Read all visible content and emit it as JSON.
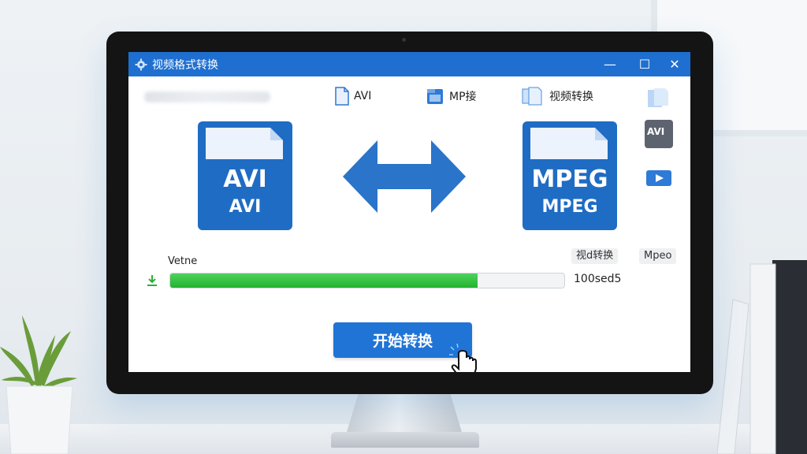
{
  "window": {
    "title": "视频格式转换",
    "controls": {
      "minimize": "—",
      "maximize": "☐",
      "close": "✕"
    }
  },
  "tabs": [
    {
      "label": "AVI",
      "icon": "document-icon"
    },
    {
      "label": "MP接",
      "icon": "folder-file-icon"
    },
    {
      "label": "视频转换",
      "icon": "copy-files-icon"
    }
  ],
  "source_file": {
    "label_top": "AVI",
    "label_bottom": "AVI",
    "color": "#1f6cc4"
  },
  "target_file": {
    "label_top": "MPEG",
    "label_bottom": "MPEG",
    "color": "#1f6cc4"
  },
  "side_icons": [
    "copy-files-icon",
    "avi-thumbnail-icon",
    "video-play-icon"
  ],
  "side_avi_text": "AVI",
  "status": {
    "label": "Vetne",
    "chip_left": "视d转换",
    "chip_right": "Mpeo",
    "progress_fraction": 0.78,
    "progress_text": "100sed5"
  },
  "start_button": {
    "label": "开始转换"
  },
  "colors": {
    "titlebar": "#1e6fd0",
    "accent_blue": "#1f74d6",
    "progress_green": "#2fc13b"
  }
}
